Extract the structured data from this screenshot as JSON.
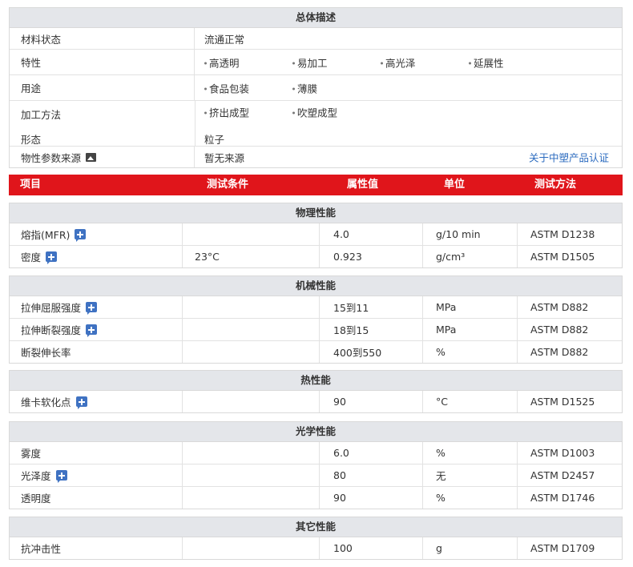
{
  "overview": {
    "title": "总体描述",
    "material_status_label": "材料状态",
    "material_status_value": "流通正常",
    "features_label": "特性",
    "features": [
      "高透明",
      "易加工",
      "高光泽",
      "延展性"
    ],
    "uses_label": "用途",
    "uses": [
      "食品包装",
      "薄膜"
    ],
    "processing_label": "加工方法",
    "processing": [
      "挤出成型",
      "吹塑成型"
    ],
    "form_label": "形态",
    "form_value": "粒子",
    "source_label": "物性参数来源",
    "source_value": "暂无来源",
    "cert_link": "关于中塑产品认证"
  },
  "header": {
    "item": "项目",
    "condition": "测试条件",
    "value": "属性值",
    "unit": "单位",
    "method": "测试方法"
  },
  "sections": [
    {
      "title": "物理性能",
      "rows": [
        {
          "name": "熔指(MFR)",
          "info": true,
          "condition": "",
          "value": "4.0",
          "unit": "g/10 min",
          "method": "ASTM D1238"
        },
        {
          "name": "密度",
          "info": true,
          "condition": "23°C",
          "value": "0.923",
          "unit": "g/cm³",
          "method": "ASTM D1505"
        }
      ]
    },
    {
      "title": "机械性能",
      "rows": [
        {
          "name": "拉伸屈服强度",
          "info": true,
          "condition": "",
          "value": "15到11",
          "unit": "MPa",
          "method": "ASTM D882"
        },
        {
          "name": "拉伸断裂强度",
          "info": true,
          "condition": "",
          "value": "18到15",
          "unit": "MPa",
          "method": "ASTM D882"
        },
        {
          "name": "断裂伸长率",
          "info": false,
          "condition": "",
          "value": "400到550",
          "unit": "%",
          "method": "ASTM D882"
        }
      ]
    },
    {
      "title": "热性能",
      "rows": [
        {
          "name": "维卡软化点",
          "info": true,
          "condition": "",
          "value": "90",
          "unit": "°C",
          "method": "ASTM D1525"
        }
      ]
    },
    {
      "title": "光学性能",
      "rows": [
        {
          "name": "雾度",
          "info": false,
          "condition": "",
          "value": "6.0",
          "unit": "%",
          "method": "ASTM D1003"
        },
        {
          "name": "光泽度",
          "info": true,
          "condition": "",
          "value": "80",
          "unit": "无",
          "method": "ASTM D2457"
        },
        {
          "name": "透明度",
          "info": false,
          "condition": "",
          "value": "90",
          "unit": "%",
          "method": "ASTM D1746"
        }
      ]
    },
    {
      "title": "其它性能",
      "rows": [
        {
          "name": "抗冲击性",
          "info": false,
          "condition": "",
          "value": "100",
          "unit": "g",
          "method": "ASTM D1709"
        }
      ]
    }
  ],
  "colors": {
    "header_red": "#e0151b",
    "section_gray": "#e4e6ea",
    "link_blue": "#2b6bbf",
    "info_blue": "#3f72c2"
  }
}
